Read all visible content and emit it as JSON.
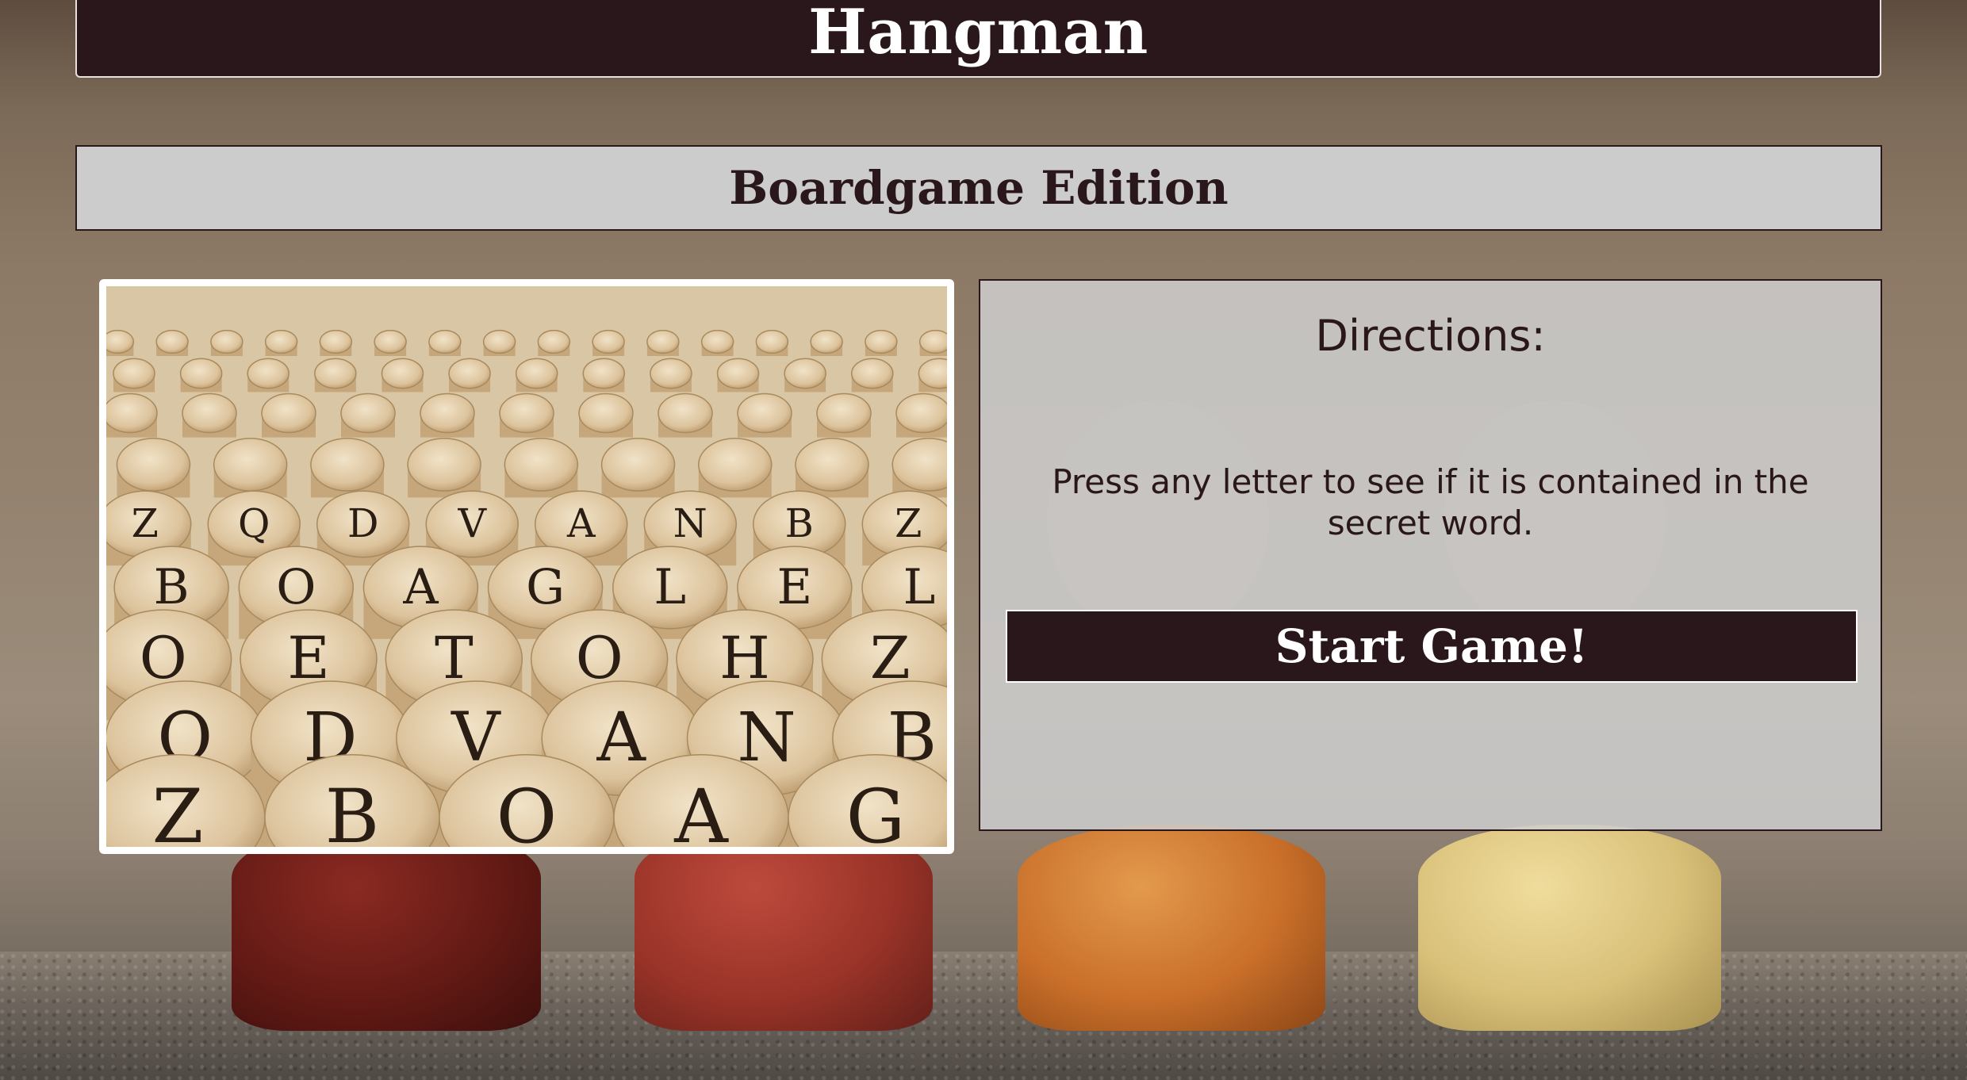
{
  "header": {
    "title": "Hangman"
  },
  "subheader": {
    "title": "Boardgame Edition"
  },
  "directions": {
    "title": "Directions:",
    "text": "Press any letter to see if it is contained in the secret word.",
    "start_button_label": "Start Game!"
  },
  "image": {
    "dice_letters": [
      "Z",
      "Q",
      "D",
      "V",
      "A",
      "N",
      "B",
      "Z",
      "B",
      "O",
      "A",
      "G",
      "L",
      "E",
      "L",
      "O",
      "E",
      "T",
      "O",
      "H"
    ]
  },
  "colors": {
    "header_bg": "#2a171b",
    "subheader_bg": "#cccccc",
    "panel_bg": "#cdcdcd",
    "button_bg": "#2a171b",
    "text_dark": "#2a171b"
  }
}
